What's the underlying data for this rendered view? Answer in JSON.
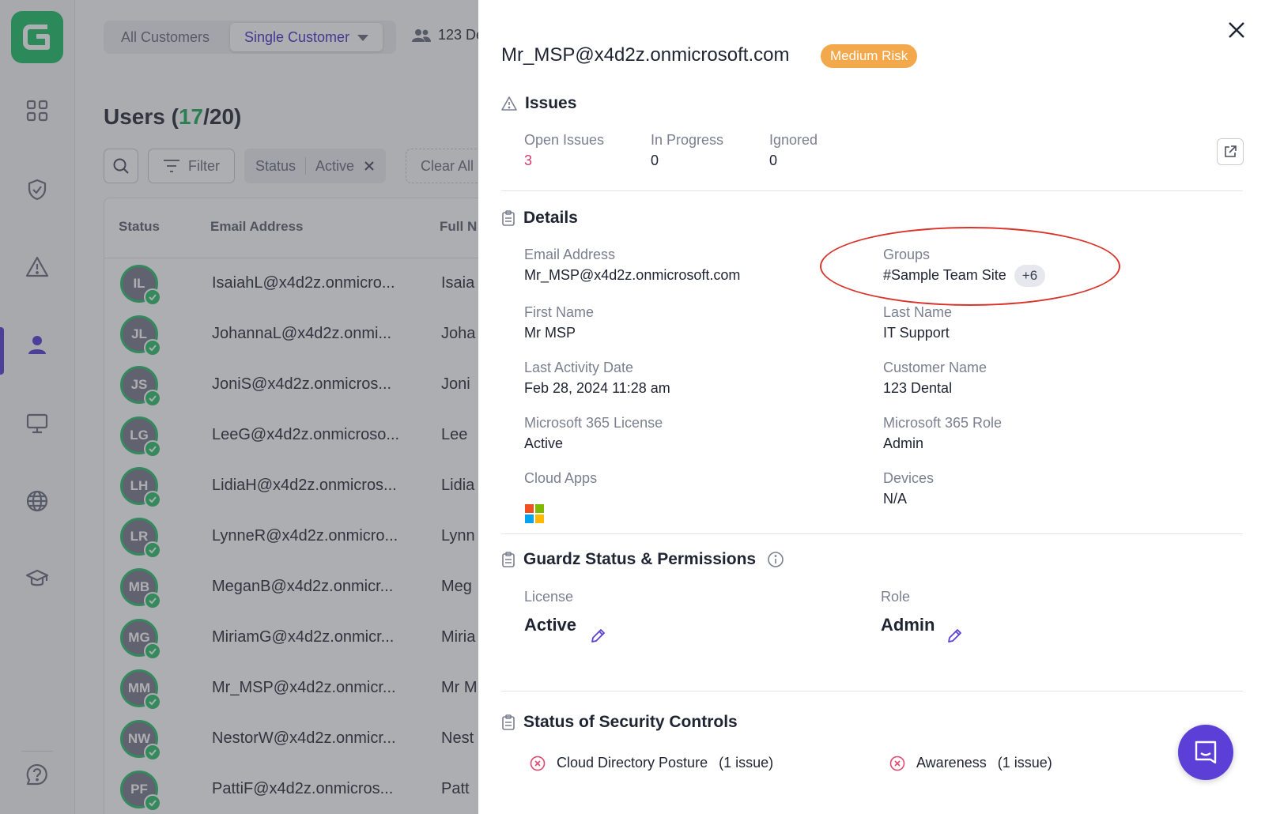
{
  "nav": {
    "items": [
      "dashboard-icon",
      "shield-icon",
      "alert-icon",
      "user-icon",
      "monitor-icon",
      "globe-icon",
      "graduation-cap-icon",
      "help-icon"
    ],
    "active": "user-icon",
    "accent": "#5b3fd6",
    "brand": "#20c069"
  },
  "toolbar": {
    "all_customers": "All Customers",
    "single_customer": "Single Customer",
    "customer_name_partial": "123 De"
  },
  "users": {
    "title_prefix": "Users (",
    "active_count": "17",
    "total_suffix": "/20)",
    "filter_label": "Filter",
    "chip_key": "Status",
    "chip_value": "Active",
    "clear_all": "Clear All",
    "columns": [
      "Status",
      "Email Address",
      "Full N"
    ],
    "rows": [
      {
        "initials": "IL",
        "email": "IsaiahL@x4d2z.onmicro...",
        "name": "Isaia"
      },
      {
        "initials": "JL",
        "email": "JohannaL@x4d2z.onmi...",
        "name": "Joha"
      },
      {
        "initials": "JS",
        "email": "JoniS@x4d2z.onmicros...",
        "name": "Joni"
      },
      {
        "initials": "LG",
        "email": "LeeG@x4d2z.onmicroso...",
        "name": "Lee"
      },
      {
        "initials": "LH",
        "email": "LidiaH@x4d2z.onmicros...",
        "name": "Lidia"
      },
      {
        "initials": "LR",
        "email": "LynneR@x4d2z.onmicro...",
        "name": "Lynn"
      },
      {
        "initials": "MB",
        "email": "MeganB@x4d2z.onmicr...",
        "name": "Meg"
      },
      {
        "initials": "MG",
        "email": "MiriamG@x4d2z.onmicr...",
        "name": "Miria"
      },
      {
        "initials": "MM",
        "email": "Mr_MSP@x4d2z.onmicr...",
        "name": "Mr M"
      },
      {
        "initials": "NW",
        "email": "NestorW@x4d2z.onmicr...",
        "name": "Nest"
      },
      {
        "initials": "PF",
        "email": "PattiF@x4d2z.onmicros...",
        "name": "Patt"
      }
    ]
  },
  "panel": {
    "title": "Mr_MSP@x4d2z.onmicrosoft.com",
    "risk_badge": "Medium Risk",
    "risk_color": "#f3a94b",
    "issues": {
      "heading": "Issues",
      "open_label": "Open Issues",
      "open_value": "3",
      "progress_label": "In Progress",
      "progress_value": "0",
      "ignored_label": "Ignored",
      "ignored_value": "0"
    },
    "details": {
      "heading": "Details",
      "email_label": "Email Address",
      "email_value": "Mr_MSP@x4d2z.onmicrosoft.com",
      "groups_label": "Groups",
      "groups_value": "#Sample Team Site",
      "groups_more": "+6",
      "first_label": "First Name",
      "first_value": "Mr MSP",
      "last_label": "Last Name",
      "last_value": "IT Support",
      "activity_label": "Last Activity Date",
      "activity_value": "Feb 28, 2024 11:28 am",
      "customer_label": "Customer Name",
      "customer_value": "123 Dental",
      "license_label": "Microsoft 365 License",
      "license_value": "Active",
      "role_label": "Microsoft 365 Role",
      "role_value": "Admin",
      "apps_label": "Cloud Apps",
      "apps_icon": "microsoft-logo-icon",
      "devices_label": "Devices",
      "devices_value": "N/A"
    },
    "guardz": {
      "heading": "Guardz Status & Permissions",
      "license_label": "License",
      "license_value": "Active",
      "role_label": "Role",
      "role_value": "Admin"
    },
    "controls": {
      "heading": "Status of Security Controls",
      "items": [
        {
          "name": "Cloud Directory Posture",
          "count": "(1 issue)"
        },
        {
          "name": "Awareness",
          "count": "(1 issue)"
        }
      ],
      "error_color": "#e0486d"
    }
  }
}
